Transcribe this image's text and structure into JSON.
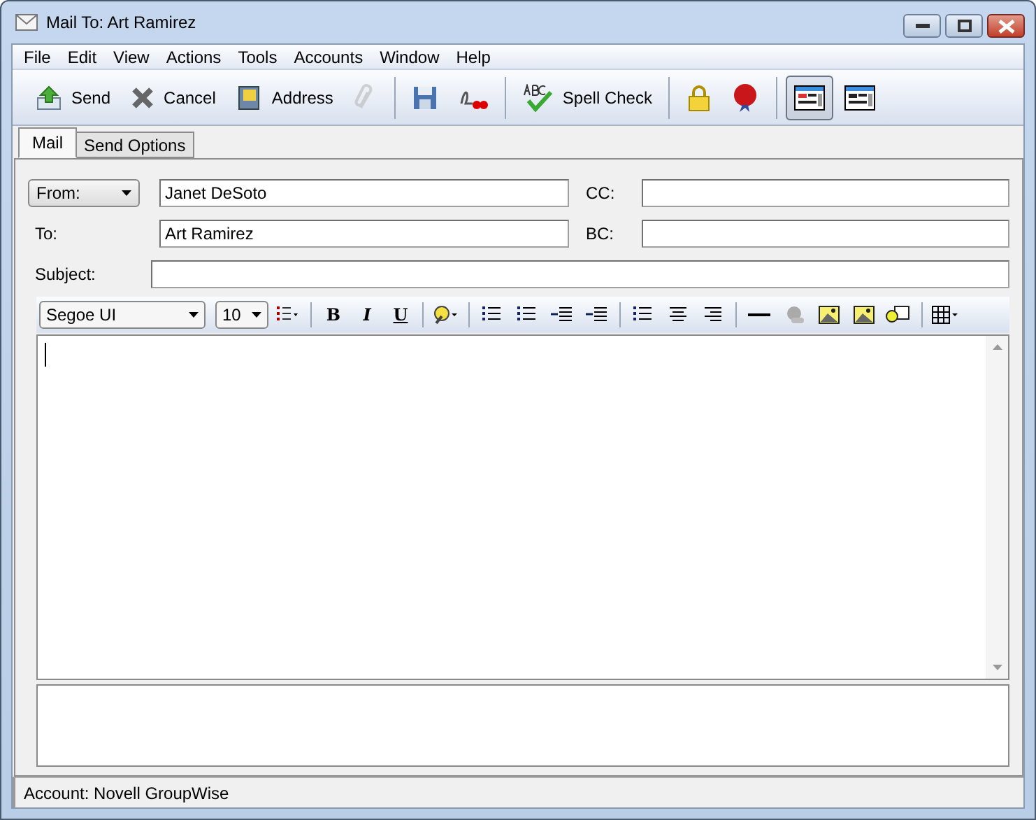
{
  "window": {
    "title": "Mail To: Art Ramirez"
  },
  "menu": [
    "File",
    "Edit",
    "View",
    "Actions",
    "Tools",
    "Accounts",
    "Window",
    "Help"
  ],
  "toolbar": [
    {
      "kind": "button",
      "label": "Send"
    },
    {
      "kind": "button",
      "label": "Cancel"
    },
    {
      "kind": "button",
      "label": "Address"
    },
    {
      "kind": "icon",
      "disabled": true
    },
    {
      "kind": "separator"
    },
    {
      "kind": "icon"
    },
    {
      "kind": "icon"
    },
    {
      "kind": "separator"
    },
    {
      "kind": "button",
      "label": "Spell Check"
    },
    {
      "kind": "separator"
    },
    {
      "kind": "icon"
    },
    {
      "kind": "icon"
    },
    {
      "kind": "separator"
    },
    {
      "kind": "toggle",
      "selected": true
    },
    {
      "kind": "toggle",
      "selected": false
    }
  ],
  "tabs": [
    {
      "label": "Mail",
      "selected": true
    },
    {
      "label": "Send Options",
      "selected": false
    }
  ],
  "fields": {
    "from": {
      "label": "From:",
      "value": "Janet DeSoto"
    },
    "cc": {
      "label": "CC:"
    },
    "to": {
      "label": "To:",
      "value": "Art Ramirez"
    },
    "bc": {
      "label": "BC:"
    },
    "subject": {
      "label": "Subject:"
    }
  },
  "format_toolbar": [
    {
      "kind": "dropdown",
      "value": "Segoe UI"
    },
    {
      "kind": "dropdown",
      "value": "10"
    },
    {
      "kind": "icon"
    },
    {
      "kind": "separator"
    },
    {
      "kind": "text",
      "label": "B"
    },
    {
      "kind": "text",
      "label": "I"
    },
    {
      "kind": "text",
      "label": "U"
    },
    {
      "kind": "separator"
    },
    {
      "kind": "icon"
    },
    {
      "kind": "separator"
    },
    {
      "kind": "icon"
    },
    {
      "kind": "icon"
    },
    {
      "kind": "icon"
    },
    {
      "kind": "icon"
    },
    {
      "kind": "separator"
    },
    {
      "kind": "icon"
    },
    {
      "kind": "icon"
    },
    {
      "kind": "icon"
    },
    {
      "kind": "separator"
    },
    {
      "kind": "icon"
    },
    {
      "kind": "icon"
    },
    {
      "kind": "icon"
    },
    {
      "kind": "icon"
    },
    {
      "kind": "icon"
    },
    {
      "kind": "separator"
    },
    {
      "kind": "icon"
    }
  ],
  "status_bar": {
    "text": "Account: Novell GroupWise"
  }
}
